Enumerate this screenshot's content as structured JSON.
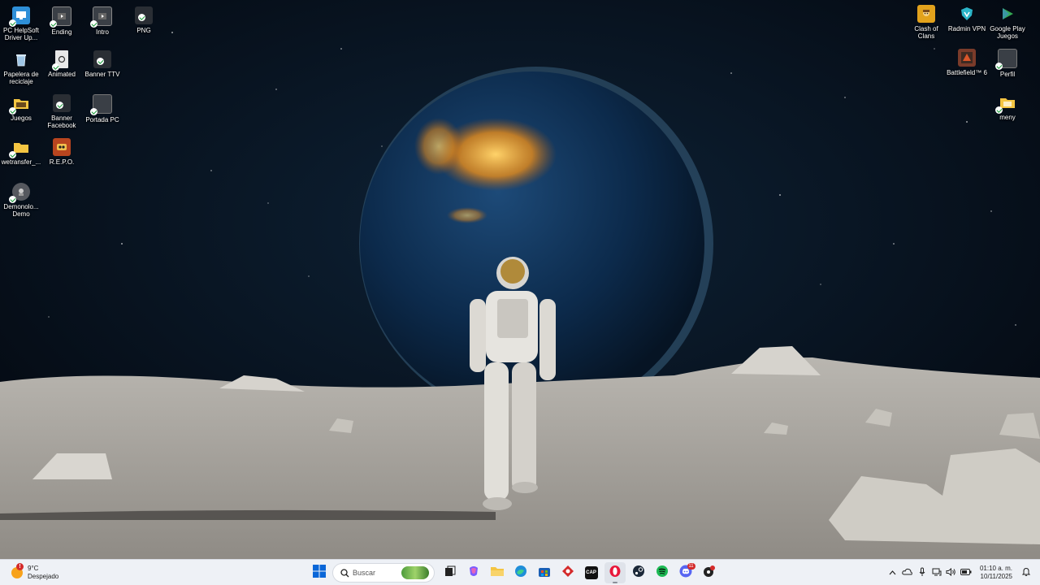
{
  "desktop": {
    "left_icons": [
      {
        "label": "PC HelpSoft Driver Up...",
        "icon": "helpsoft-icon",
        "color": "#2e8fd8"
      },
      {
        "label": "Ending",
        "icon": "video-file-icon",
        "color": "#3a3f46"
      },
      {
        "label": "Intro",
        "icon": "video-file-icon",
        "color": "#3a3f46"
      },
      {
        "label": "PNG",
        "icon": "image-file-icon",
        "color": "#3a3f46"
      },
      {
        "label": "Papelera de reciclaje",
        "icon": "recycle-bin-icon",
        "color": "#9fc6e6"
      },
      {
        "label": "Animated",
        "icon": "document-file-icon",
        "color": "#e8e8e8"
      },
      {
        "label": "Banner TTV",
        "icon": "image-file-icon",
        "color": "#3a3f46"
      },
      {
        "label": "Juegos",
        "icon": "folder-icon",
        "color": "#f4c542"
      },
      {
        "label": "Banner Facebook",
        "icon": "image-file-icon",
        "color": "#3a3f46"
      },
      {
        "label": "Portada PC",
        "icon": "image-file-icon",
        "color": "#3a3f46"
      },
      {
        "label": "wetransfer_...",
        "icon": "folder-icon",
        "color": "#f4c542"
      },
      {
        "label": "R.E.P.O.",
        "icon": "game-repo-icon",
        "color": "#b8451f"
      },
      {
        "label": "Demonolo... Demo",
        "icon": "game-demonologist-icon",
        "color": "#55585e"
      }
    ],
    "right_icons": [
      {
        "label": "Clash of Clans",
        "icon": "clash-of-clans-icon",
        "color": "#e2a21c"
      },
      {
        "label": "Radmin VPN",
        "icon": "radmin-vpn-icon",
        "color": "#2bb6c9"
      },
      {
        "label": "Google Play Juegos",
        "icon": "google-play-games-icon",
        "color": "#34a853"
      },
      {
        "label": "Battlefield™ 6",
        "icon": "battlefield-icon",
        "color": "#7a3b2a"
      },
      {
        "label": "Perfil",
        "icon": "image-file-icon",
        "color": "#3a3f46"
      },
      {
        "label": "meny",
        "icon": "folder-icon",
        "color": "#f4c542"
      }
    ]
  },
  "taskbar": {
    "weather": {
      "temperature": "9°C",
      "condition": "Despejado",
      "alert": "!"
    },
    "search": {
      "placeholder": "Buscar"
    },
    "apps": [
      {
        "name": "start",
        "icon": "windows-start-icon",
        "color": "#0a66d8"
      },
      {
        "name": "task-view",
        "icon": "task-view-icon",
        "color": "#222222"
      },
      {
        "name": "copilot",
        "icon": "copilot-icon",
        "color": "#7a5cff"
      },
      {
        "name": "file-explorer",
        "icon": "folder-icon",
        "color": "#f4c542"
      },
      {
        "name": "edge",
        "icon": "edge-icon",
        "color": "#1f8ed8"
      },
      {
        "name": "store",
        "icon": "store-icon",
        "color": "#1a5fb4"
      },
      {
        "name": "red-app",
        "icon": "red-app-icon",
        "color": "#d42a2a"
      },
      {
        "name": "capcut",
        "icon": "capcut-icon",
        "color": "#111111",
        "text": "CAP"
      },
      {
        "name": "opera",
        "icon": "opera-icon",
        "color": "#e8173a"
      },
      {
        "name": "steam",
        "icon": "steam-icon",
        "color": "#1b2838"
      },
      {
        "name": "spotify",
        "icon": "spotify-icon",
        "color": "#1db954"
      },
      {
        "name": "discord",
        "icon": "discord-icon",
        "color": "#5865f2",
        "badge": "11"
      },
      {
        "name": "dark-app",
        "icon": "dark-app-icon",
        "color": "#222222"
      }
    ],
    "tray": {
      "time": "01:10 a. m.",
      "date": "10/11/2025"
    }
  }
}
